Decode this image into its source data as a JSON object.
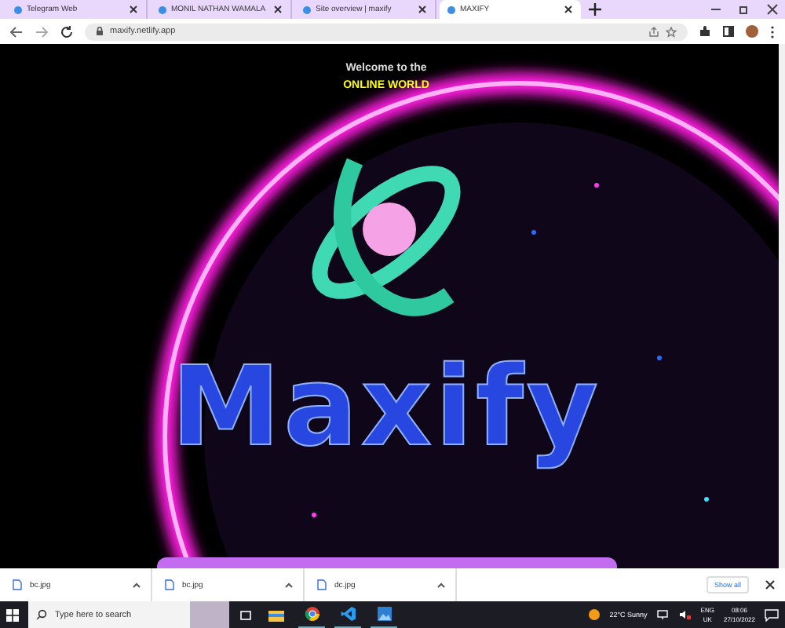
{
  "browser": {
    "tabs": [
      {
        "title": "Telegram Web",
        "selected": false
      },
      {
        "title": "MONIL NATHAN WAMALA",
        "selected": false
      },
      {
        "title": "Site overview | maxify",
        "selected": false
      },
      {
        "title": "MAXIFY",
        "selected": true
      }
    ],
    "address": "maxify.netlify.app"
  },
  "page": {
    "welcome": "Welcome to the",
    "headline": "ONLINE WORLD",
    "logo_text": "Maxify"
  },
  "downloads": {
    "items": [
      {
        "name": "bc.jpg"
      },
      {
        "name": "bc.jpg"
      },
      {
        "name": "dc.jpg"
      }
    ],
    "show_all": "Show all"
  },
  "taskbar": {
    "search_placeholder": "Type here to search",
    "weather": "22°C  Sunny",
    "language": "ENG",
    "region": "UK",
    "time": "08:06",
    "date": "27/10/2022"
  }
}
